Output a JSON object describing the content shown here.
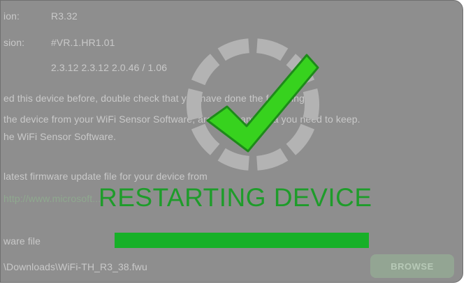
{
  "background": {
    "version_label": "ion:",
    "version_value": "R3.32",
    "revision_label": "sion:",
    "revision_value": "#VR.1.HR1.01",
    "software_versions": "2.3.12 2.3.12 2.0.46 / 1.06",
    "instruction_line_1": "ed this device before, double check that you have done the following...",
    "instruction_line_2": "the device from your WiFi Sensor Software, archiving any data you need to keep.",
    "instruction_line_3": "he WiFi Sensor Software.",
    "download_line": "latest firmware update file for your device from",
    "download_link": "http://www.microsoft...",
    "firmware_file_label": "ware file",
    "firmware_path": "\\Downloads\\WiFi-TH_R3_38.fwu",
    "browse_label": "BROWSE"
  },
  "overlay": {
    "status_title": "RESTARTING DEVICE",
    "progress_fraction": 1.0
  },
  "colors": {
    "accent_green": "#17b028",
    "title_green": "#1e9c2a",
    "check_green": "#37d21e",
    "ring_gray": "#b3b3b3"
  },
  "icons": {
    "status_icon": "check-ring-icon"
  }
}
